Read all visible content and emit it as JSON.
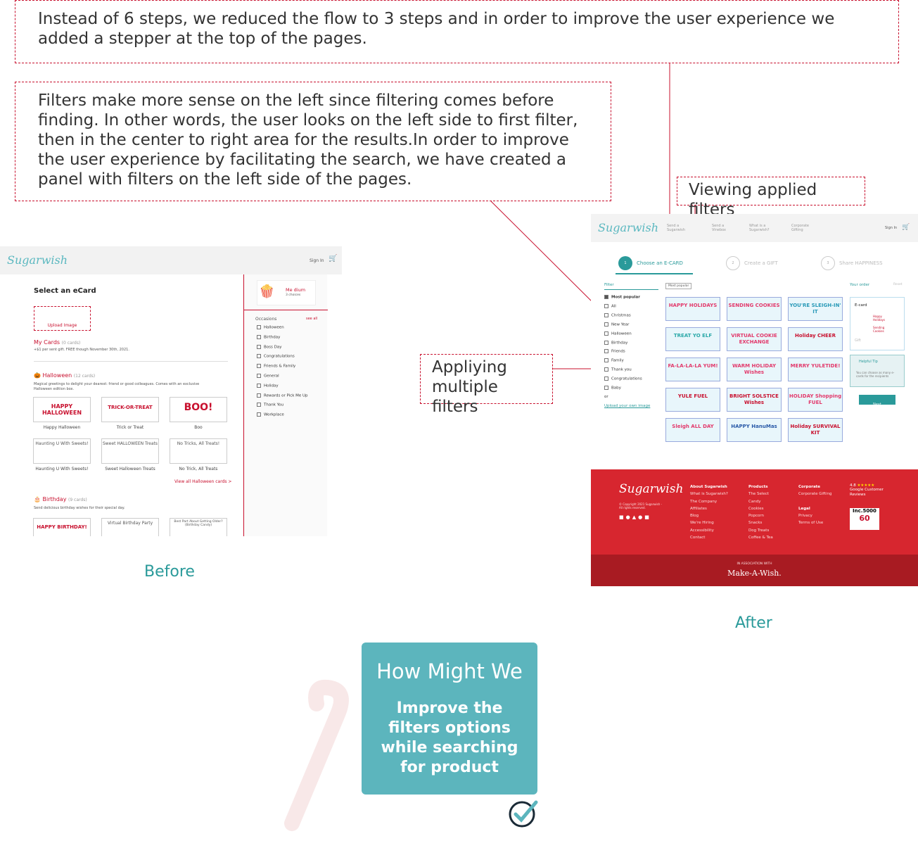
{
  "notes": {
    "steps": "Instead of 6 steps, we reduced the flow to 3 steps and in order to improve the user experience we added a stepper at the top of the pages.",
    "filters": "Filters make more sense on the left since filtering comes before finding. In other words, the user looks on the left side to first filter, then in the center to right area for the results.In order to improve the user experience by facilitating the search, we have created a panel with filters on the left side of the pages.",
    "viewing": "Viewing applied filters",
    "applying": "Appliying multiple filters"
  },
  "captions": {
    "before": "Before",
    "after": "After"
  },
  "hmw": {
    "title": "How Might We",
    "body": "Improve the filters options while searching for product"
  },
  "before": {
    "logo": "Sugarwish",
    "sign_in": "Sign In",
    "select_title": "Select an eCard",
    "upload": "Upload Image",
    "my_cards": "My Cards",
    "my_cards_count": "(0 cards)",
    "my_cards_note": "+$1 per sent gift. FREE though November 30th, 2021.",
    "halloween": "Halloween",
    "halloween_count": "(12 cards)",
    "halloween_desc": "Magical greetings to delight your dearest: friend or good colleagues. Comes with an exclusive Halloween edition box.",
    "cards_row1": [
      {
        "art": "HAPPY HALLOWEEN",
        "label": "Happy Halloween"
      },
      {
        "art": "TRICK-OR-TREAT",
        "label": "Trick or Treat"
      },
      {
        "art": "BOO!",
        "label": "Boo"
      }
    ],
    "cards_row2": [
      {
        "art": "Haunting U With Sweets!",
        "label": "Haunting U With Sweets!"
      },
      {
        "art": "Sweet HALLOWEEN Treats",
        "label": "Sweet Halloween Treats"
      },
      {
        "art": "No Tricks, All Treats!",
        "label": "No Trick, All Treats"
      }
    ],
    "view_all": "View all Halloween cards >",
    "birthday": "Birthday",
    "birthday_count": "(9 cards)",
    "birthday_desc": "Send delicious birthday wishes for their special day.",
    "cards_row3": [
      "HAPPY BIRTHDAY!",
      "Virtual Birthday Party",
      "Best Part About Getting Older? (Birthday Candy)"
    ],
    "product_name": "Me dium",
    "product_sub": "3 choices",
    "occasions": "Occasions",
    "see_all": "see all",
    "occasion_list": [
      "Halloween",
      "Birthday",
      "Boss Day",
      "Congratulations",
      "Friends & Family",
      "General",
      "Holiday",
      "Rewards or Pick Me Up",
      "Thank You",
      "Workplace"
    ]
  },
  "after": {
    "logo": "Sugarwish",
    "nav": [
      "Send a Sugarwish",
      "Send a Vinebox",
      "What is a Sugarwish?",
      "Corporate Gifting"
    ],
    "sign_in": "Sign In",
    "steps": [
      {
        "n": "1",
        "label": "Choose an E-CARD"
      },
      {
        "n": "2",
        "label": "Create a GIFT"
      },
      {
        "n": "3",
        "label": "Share HAPPINESS"
      }
    ],
    "filter_title": "Filter",
    "sort": "Most popular",
    "filters": [
      "Most popular",
      "All",
      "Christmas",
      "New Year",
      "Halloween",
      "Birthday",
      "Friends",
      "Family",
      "Thank you",
      "Congratulations",
      "Baby",
      "or",
      "Upload your own image"
    ],
    "cards": [
      "HAPPY HOLIDAYS",
      "SENDING COOKIES",
      "YOU'RE SLEIGH-IN' IT",
      "TREAT YO ELF",
      "VIRTUAL COOKIE EXCHANGE",
      "Holiday CHEER",
      "FA-LA-LA-LA YUM!",
      "WARM HOLIDAY Wishes",
      "MERRY YULETIDE!",
      "YULE FUEL",
      "BRIGHT SOLSTICE Wishes",
      "HOLIDAY Shopping FUEL",
      "Sleigh ALL DAY",
      "HAPPY HanuMas",
      "Holiday SURVIVAL KIT"
    ],
    "order_title": "Your order",
    "order_reset": "Reset",
    "ecard": "E-card",
    "order_items": [
      "Happy Holidays",
      "Sending Cookies"
    ],
    "gift": "Gift",
    "tip_title": "Helpful Tip",
    "tip_body": "You can choose as many e-cards for the recipients",
    "next": "Next",
    "footer": {
      "logo": "Sugarwish",
      "copyright": "© Copyright 2021 Sugarwish - All rights reserved.",
      "about_title": "About Sugarwish",
      "about": [
        "What is Sugarwish?",
        "The Company",
        "Affiliates",
        "Blog",
        "We're Hiring",
        "Accessibility",
        "Contact"
      ],
      "products_title": "Products",
      "products": [
        "The Select",
        "Candy",
        "Cookies",
        "Popcorn",
        "Snacks",
        "Dog Treats",
        "Coffee & Tea"
      ],
      "corporate_title": "Corporate",
      "corporate": [
        "Corporate Gifting"
      ],
      "legal_title": "Legal",
      "legal": [
        "Privacy",
        "Terms of Use"
      ],
      "rating": "4.8",
      "reviews": "Google Customer Reviews",
      "inc": "Inc.5000",
      "inc_num": "60",
      "assoc": "IN ASSOCIATION WITH",
      "maw": "Make-A-Wish."
    }
  },
  "colors": {
    "accent_red": "#c8102e",
    "teal": "#5cb5bd",
    "footer_red": "#d7262f"
  }
}
